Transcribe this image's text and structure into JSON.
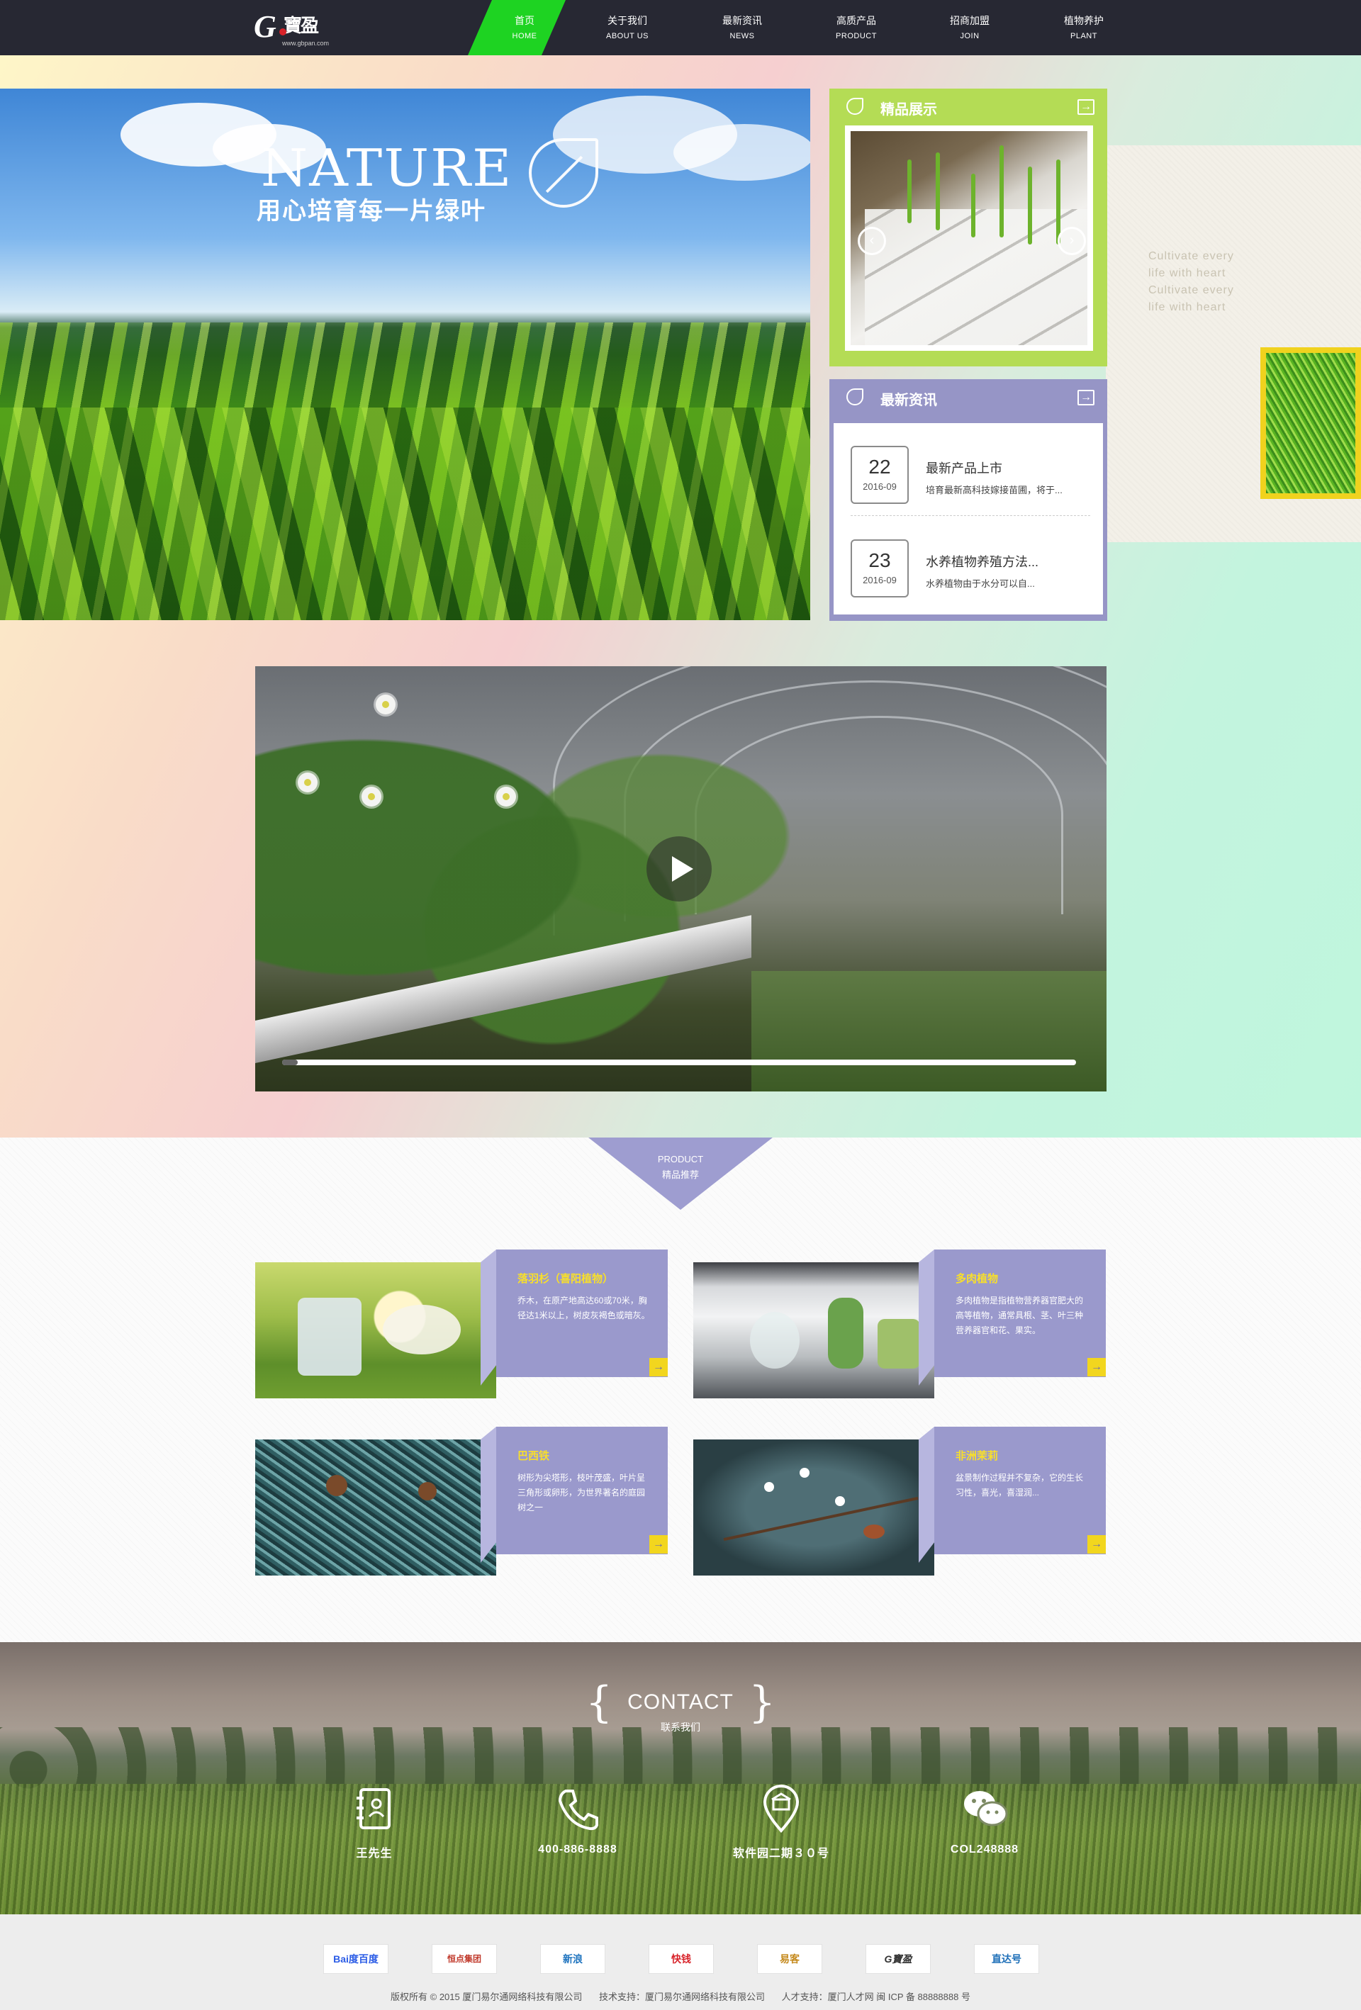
{
  "header": {
    "logo_text": "G寶盈",
    "logo_url": "www.gbpan.com",
    "nav": [
      {
        "cn": "首页",
        "en": "HOME",
        "active": true
      },
      {
        "cn": "关于我们",
        "en": "ABOUT US"
      },
      {
        "cn": "最新资讯",
        "en": "NEWS"
      },
      {
        "cn": "高质产品",
        "en": "PRODUCT"
      },
      {
        "cn": "招商加盟",
        "en": "JOIN"
      },
      {
        "cn": "植物养护",
        "en": "PLANT"
      }
    ]
  },
  "hero": {
    "title_en": "NATURE",
    "title_cn": "用心培育每一片绿叶",
    "side_quote": "Cultivate every life with heart Cultivate every life with heart"
  },
  "featured": {
    "title": "精品展示",
    "prev": "‹",
    "next": "›"
  },
  "news": {
    "title": "最新资讯",
    "items": [
      {
        "day": "22",
        "ym": "2016-09",
        "title": "最新产品上市",
        "desc": "培育最新高科技嫁接苗圃，将于..."
      },
      {
        "day": "23",
        "ym": "2016-09",
        "title": "水养植物养殖方法...",
        "desc": "水养植物由于水分可以自..."
      }
    ]
  },
  "video": {
    "progress": 0.02
  },
  "product": {
    "tab_en": "PRODUCT",
    "tab_cn": "精品推荐",
    "cards": [
      {
        "title": "落羽杉（喜阳植物）",
        "desc": "乔木，在原产地高达60或70米，胸径达1米以上，树皮灰褐色或暗灰。"
      },
      {
        "title": "多肉植物",
        "desc": "多肉植物是指植物营养器官肥大的高等植物，通常具根、茎、叶三种营养器官和花、果实。"
      },
      {
        "title": "巴西铁",
        "desc": "树形为尖塔形，枝叶茂盛，叶片呈三角形或卵形，为世界著名的庭园树之一"
      },
      {
        "title": "非洲茉莉",
        "desc": "盆景制作过程并不复杂，它的生长习性，喜光，喜湿润..."
      }
    ]
  },
  "contact": {
    "title": "CONTACT",
    "subtitle": "联系我们",
    "items": [
      {
        "icon": "contact-book-icon",
        "text": "王先生"
      },
      {
        "icon": "phone-icon",
        "text": "400-886-8888"
      },
      {
        "icon": "location-icon",
        "text": "软件园二期３０号"
      },
      {
        "icon": "wechat-icon",
        "text": "COL248888"
      }
    ]
  },
  "footer": {
    "partners": [
      "Bai度百度",
      "恒点集团",
      "新浪",
      "快钱",
      "易客",
      "G寶盈",
      "直达号"
    ],
    "copyright": "版权所有 © 2015 厦门易尔通网络科技有限公司",
    "tech": "技术支持：厦门易尔通网络科技有限公司",
    "talent": "人才支持：厦门人才网 闽 ICP 备 88888888 号"
  },
  "colors": {
    "nav_bg": "#272833",
    "nav_active": "#1ed322",
    "green_panel": "#b4dc55",
    "purple_panel": "#9695c6",
    "accent_yellow": "#f2d61e"
  }
}
